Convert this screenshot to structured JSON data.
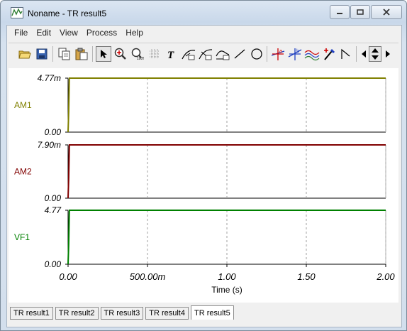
{
  "window": {
    "title": "Noname - TR result5",
    "controls": [
      "minimize-icon",
      "restore-icon",
      "close-icon"
    ]
  },
  "menu": [
    "File",
    "Edit",
    "View",
    "Process",
    "Help"
  ],
  "toolbar": {
    "buttons": [
      "open-folder-icon",
      "save-icon",
      "copy-icon",
      "paste-icon",
      "pointer-icon",
      "zoom-in-icon",
      "zoom-100-icon",
      "grid-icon",
      "text-icon",
      "curve-a-icon",
      "curve-b-icon",
      "curve-c-icon",
      "line-icon",
      "circle-icon",
      "cursor-a-icon",
      "cursor-b-icon",
      "waveform-icon",
      "pen-icon",
      "marker-icon",
      "arrow-left-icon",
      "arrow-updown-icon",
      "arrow-right-icon"
    ]
  },
  "chart_data": {
    "type": "line",
    "xlabel": "Time (s)",
    "x_ticks": [
      "0.00",
      "500.00m",
      "1.00",
      "1.50",
      "2.00"
    ],
    "xlim": [
      0,
      2
    ],
    "grid": true,
    "panels": [
      {
        "name": "AM1",
        "color": "#808000",
        "ymin_label": "0.00",
        "ymax_label": "4.77m",
        "ylim": [
          0,
          0.00477
        ],
        "points": [
          [
            0,
            0
          ],
          [
            0.004,
            0.0018
          ],
          [
            0.008,
            0.00477
          ],
          [
            2.0,
            0.00477
          ]
        ]
      },
      {
        "name": "AM2",
        "color": "#800000",
        "ymin_label": "0.00",
        "ymax_label": "7.90m",
        "ylim": [
          0,
          0.0079
        ],
        "points": [
          [
            0,
            0
          ],
          [
            0.004,
            0.003
          ],
          [
            0.008,
            0.0079
          ],
          [
            2.0,
            0.0079
          ]
        ]
      },
      {
        "name": "VF1",
        "color": "#008000",
        "ymin_label": "0.00",
        "ymax_label": "4.77",
        "ylim": [
          0,
          4.77
        ],
        "points": [
          [
            0,
            0
          ],
          [
            0.004,
            1.8
          ],
          [
            0.008,
            4.77
          ],
          [
            2.0,
            4.77
          ]
        ]
      }
    ]
  },
  "tabs": [
    {
      "label": "TR result1",
      "active": false
    },
    {
      "label": "TR result2",
      "active": false
    },
    {
      "label": "TR result3",
      "active": false
    },
    {
      "label": "TR result4",
      "active": false
    },
    {
      "label": "TR result5",
      "active": true
    }
  ]
}
